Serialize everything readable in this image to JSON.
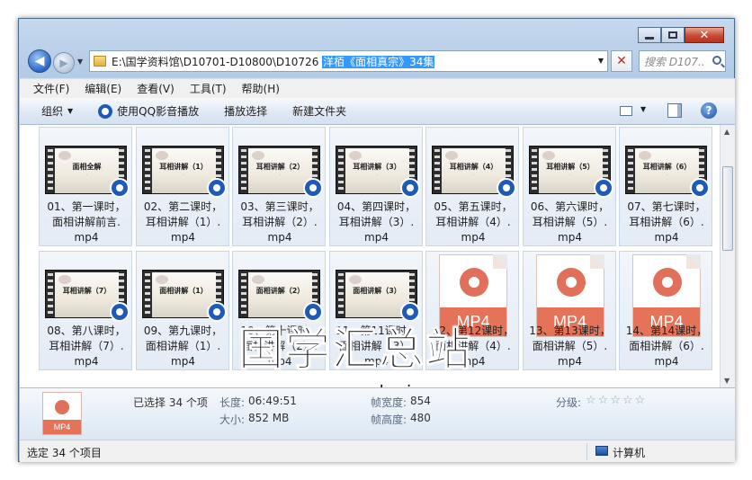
{
  "window": {
    "title": ""
  },
  "address": {
    "path_plain": "E:\\国学资料馆\\D10701-D10800\\D10726 ",
    "path_selected": "洋栢《面相真宗》34集"
  },
  "search": {
    "placeholder": "搜索 D107..."
  },
  "menu": [
    "文件(F)",
    "编辑(E)",
    "查看(V)",
    "工具(T)",
    "帮助(H)"
  ],
  "commands": {
    "organize": "组织",
    "play_qq": "使用QQ影音播放",
    "play_sel": "播放选择",
    "new_folder": "新建文件夹"
  },
  "files": [
    {
      "kind": "thumb",
      "thumb_title": "面相全解",
      "lines": [
        "01、第一课时，",
        "面相讲解前言.",
        "mp4"
      ]
    },
    {
      "kind": "thumb",
      "thumb_title": "耳相讲解（1）",
      "lines": [
        "02、第二课时，",
        "耳相讲解（1）.",
        "mp4"
      ]
    },
    {
      "kind": "thumb",
      "thumb_title": "耳相讲解（2）",
      "lines": [
        "03、第三课时，",
        "耳相讲解（2）.",
        "mp4"
      ]
    },
    {
      "kind": "thumb",
      "thumb_title": "耳相讲解（3）",
      "lines": [
        "04、第四课时，",
        "耳相讲解（3）.",
        "mp4"
      ]
    },
    {
      "kind": "thumb",
      "thumb_title": "耳相讲解（4）",
      "lines": [
        "05、第五课时，",
        "耳相讲解（4）.",
        "mp4"
      ]
    },
    {
      "kind": "thumb",
      "thumb_title": "耳相讲解（5）",
      "lines": [
        "06、第六课时，",
        "耳相讲解（5）.",
        "mp4"
      ]
    },
    {
      "kind": "thumb",
      "thumb_title": "耳相讲解（6）",
      "lines": [
        "07、第七课时，",
        "耳相讲解（6）.",
        "mp4"
      ]
    },
    {
      "kind": "thumb",
      "thumb_title": "耳相讲解（7）",
      "lines": [
        "08、第八课时，",
        "耳相讲解（7）.",
        "mp4"
      ]
    },
    {
      "kind": "thumb",
      "thumb_title": "面相讲解（1）",
      "lines": [
        "09、第九课时，",
        "面相讲解（1）.",
        "mp4"
      ]
    },
    {
      "kind": "thumb",
      "thumb_title": "面相讲解（2）",
      "lines": [
        "10、第十课时，",
        "面相讲解（2）.",
        "mp4"
      ]
    },
    {
      "kind": "thumb",
      "thumb_title": "面相讲解（3）",
      "lines": [
        "11、第11课时，",
        "面相讲解（3）.",
        "mp4"
      ]
    },
    {
      "kind": "mp4",
      "band": "MP4",
      "lines": [
        "12、第12课时，",
        "面相讲解（4）.",
        "mp4"
      ]
    },
    {
      "kind": "mp4",
      "band": "MP4",
      "lines": [
        "13、第13课时，",
        "面相讲解（5）.",
        "mp4"
      ]
    },
    {
      "kind": "mp4",
      "band": "MP4",
      "lines": [
        "14、第14课时，",
        "面相讲解（6）.",
        "mp4"
      ]
    }
  ],
  "watermark": {
    "cn": "国学汇总站",
    "url": "www.guoxuehuizong.com"
  },
  "details": {
    "icon_band": "MP4",
    "selected": "已选择 34 个项",
    "duration_label": "长度:",
    "duration": "06:49:51",
    "size_label": "大小:",
    "size": "852 MB",
    "fw_label": "帧宽度:",
    "frame_width": "854",
    "fh_label": "帧高度:",
    "frame_height": "480",
    "rating_label": "分级:",
    "rating": 0,
    "rating_max": 5
  },
  "status": {
    "selected": "选定 34 个项目",
    "computer": "计算机"
  }
}
